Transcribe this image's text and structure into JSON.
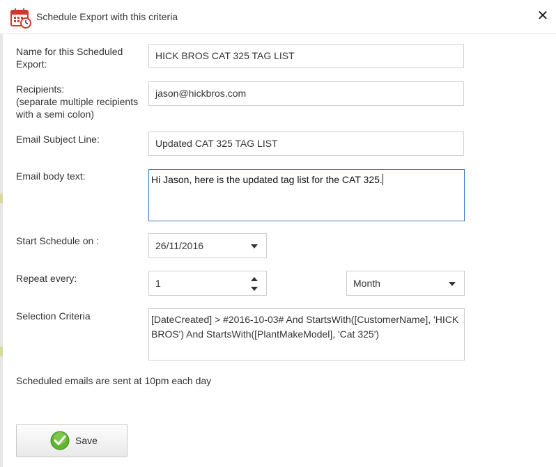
{
  "dialog": {
    "title": "Schedule Export with this criteria",
    "close_symbol": "✕"
  },
  "form": {
    "name_label_line1": "Name for this Scheduled",
    "name_label_line2": "Export:",
    "name_value": "HICK BROS CAT 325 TAG LIST",
    "recipients_label": "Recipients:",
    "recipients_hint_line1": "(separate multiple recipients",
    "recipients_hint_line2": "with a semi colon)",
    "recipients_value": "jason@hickbros.com",
    "subject_label": "Email Subject Line:",
    "subject_value": "Updated CAT 325 TAG LIST",
    "body_label": "Email body text:",
    "body_value": "Hi Jason, here is the updated tag list for the CAT 325.",
    "start_label": "Start Schedule on :",
    "start_value": "26/11/2016",
    "repeat_label": "Repeat every:",
    "repeat_count": "1",
    "repeat_unit": "Month",
    "criteria_label": "Selection Criteria",
    "criteria_value": "[DateCreated] > #2016-10-03# And StartsWith([CustomerName], 'HICK BROS') And StartsWith([PlantMakeModel], 'Cat 325')"
  },
  "footer": {
    "note": "Scheduled emails are sent at 10pm each day",
    "save_label": "Save"
  },
  "icons": {
    "title": "calendar-clock-icon",
    "save": "green-check-icon"
  },
  "colors": {
    "focus_border": "#3a79c4",
    "check_green": "#5fb52f",
    "calendar_red": "#d9342b"
  }
}
